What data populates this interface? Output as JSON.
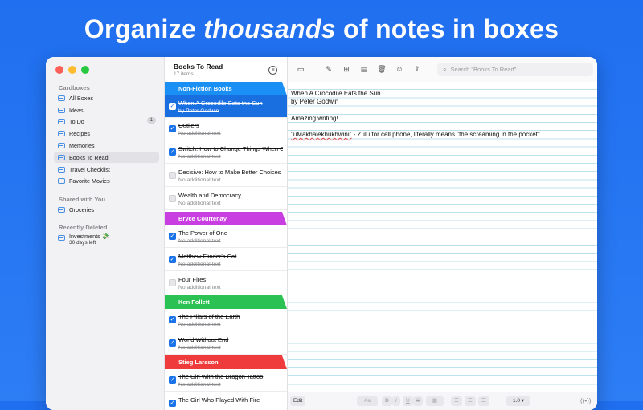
{
  "headline": {
    "part1": "Organize ",
    "part2": "thousands",
    "part3": " of notes in boxes"
  },
  "sidebar": {
    "cardboxes_title": "Cardboxes",
    "items": [
      {
        "label": "All Boxes"
      },
      {
        "label": "Ideas"
      },
      {
        "label": "To Do",
        "badge": "1"
      },
      {
        "label": "Recipes"
      },
      {
        "label": "Memories"
      },
      {
        "label": "Books To Read",
        "active": true
      },
      {
        "label": "Travel Checklist"
      },
      {
        "label": "Favorite Movies"
      }
    ],
    "shared_title": "Shared with You",
    "shared_items": [
      {
        "label": "Groceries"
      }
    ],
    "deleted_title": "Recently Deleted",
    "deleted_items": [
      {
        "label": "Investments 💸",
        "sub": "30 days left"
      }
    ]
  },
  "list": {
    "title": "Books To Read",
    "count": "17 items",
    "groups": [
      {
        "name": "Non-Fiction Books",
        "color": "#1a90f5"
      },
      {
        "name": "Bryce Courtenay",
        "color": "#c93ee0"
      },
      {
        "name": "Ken Follett",
        "color": "#2bc253"
      },
      {
        "name": "Stieg Larsson",
        "color": "#ef3b3b"
      }
    ],
    "notes": [
      {
        "title": "When A Crocodile Eats the Sun",
        "sub": "by Peter Godwin",
        "checked": true,
        "selected": true
      },
      {
        "title": "Outliers",
        "sub": "No additional text",
        "checked": true
      },
      {
        "title": "Switch: How to Change Things When Change Is Hard",
        "sub": "No additional text",
        "checked": true
      },
      {
        "title": "Decisive: How to Make Better Choices",
        "sub": "No additional text",
        "checked": false
      },
      {
        "title": "Wealth and Democracy",
        "sub": "No additional text",
        "checked": false
      },
      {
        "title": "The Power of One",
        "sub": "No additional text",
        "checked": true
      },
      {
        "title": "Matthew Flinder's Cat",
        "sub": "No additional text",
        "checked": true
      },
      {
        "title": "Four Fires",
        "sub": "No additional text",
        "checked": false
      },
      {
        "title": "The Pillars of the Earth",
        "sub": "No additional text",
        "checked": true
      },
      {
        "title": "World Without End",
        "sub": "No additional text",
        "checked": true
      },
      {
        "title": "The Girl With the Dragon Tattoo",
        "sub": "No additional text",
        "checked": true
      },
      {
        "title": "The Girl Who Played With Fire",
        "sub": "",
        "checked": true
      }
    ]
  },
  "editor": {
    "search_placeholder": "Search \"Books To Read\"",
    "line1": "When A Crocodile Eats the Sun",
    "line2": "by Peter Godwin",
    "line3": "Amazing writing!",
    "line4_word": "\"uMakhalekhukhwini\"",
    "line4_rest": " - Zulu for cell phone, literally means \"the screaming in the pocket\"."
  },
  "statusbar": {
    "edit": "Edit",
    "font": "Aa",
    "bold": "B",
    "italic": "I",
    "underline": "U",
    "strike": "S",
    "spacing": "1.0"
  }
}
